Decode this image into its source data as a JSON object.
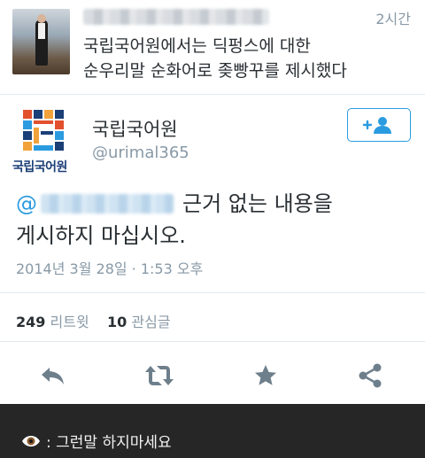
{
  "top_tweet": {
    "time": "2시간",
    "text_line1": "국립국어원에서는 딕펑스에 대한",
    "text_line2": "순우리말 순화어로 좆빵꾸를 제시했다"
  },
  "tweet": {
    "account_name": "국립국어원",
    "logo_label": "국립국어원",
    "handle": "@urimal365",
    "mention_prefix": "@",
    "text_line1_suffix": "근거 없는 내용을",
    "text_line2": "게시하지 마십시오.",
    "date": "2014년 3월 28일 · 1:53 오후",
    "retweets_count": "249",
    "retweets_label": "리트윗",
    "favorites_count": "10",
    "favorites_label": "관심글"
  },
  "caption": {
    "text": ": 그런말 하지마세요"
  },
  "colors": {
    "accent": "#2b9be0",
    "muted": "#8899a6",
    "text": "#292f33",
    "caption_bg": "#262626"
  },
  "icons": [
    "reply-icon",
    "retweet-icon",
    "favorite-icon",
    "share-icon",
    "follow-icon",
    "eye-icon"
  ]
}
